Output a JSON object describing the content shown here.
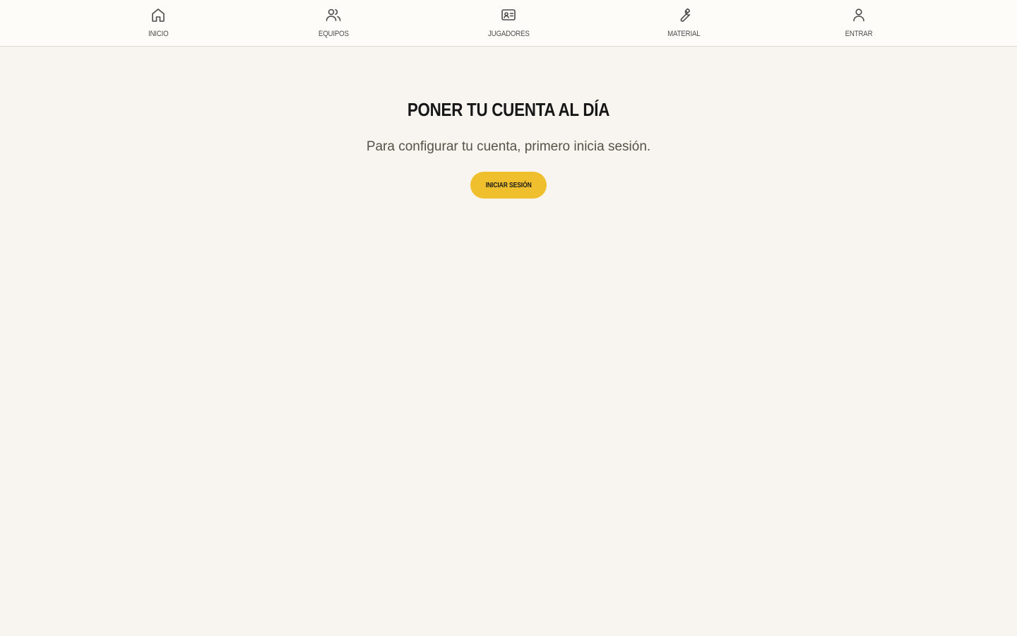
{
  "nav": {
    "items": [
      {
        "label": "INICIO",
        "icon": "home-icon"
      },
      {
        "label": "EQUIPOS",
        "icon": "users-icon"
      },
      {
        "label": "JUGADORES",
        "icon": "id-card-icon"
      },
      {
        "label": "MATERIAL",
        "icon": "wrench-icon"
      },
      {
        "label": "ENTRAR",
        "icon": "user-icon"
      }
    ]
  },
  "main": {
    "title": "PONER TU CUENTA AL DÍA",
    "subtitle": "Para configurar tu cuenta, primero inicia sesión.",
    "login_button": "INICIAR SESIÓN"
  },
  "colors": {
    "background": "#f8f5f0",
    "nav_background": "#fdfcf9",
    "accent": "#f0bf2e",
    "text": "#161616"
  }
}
